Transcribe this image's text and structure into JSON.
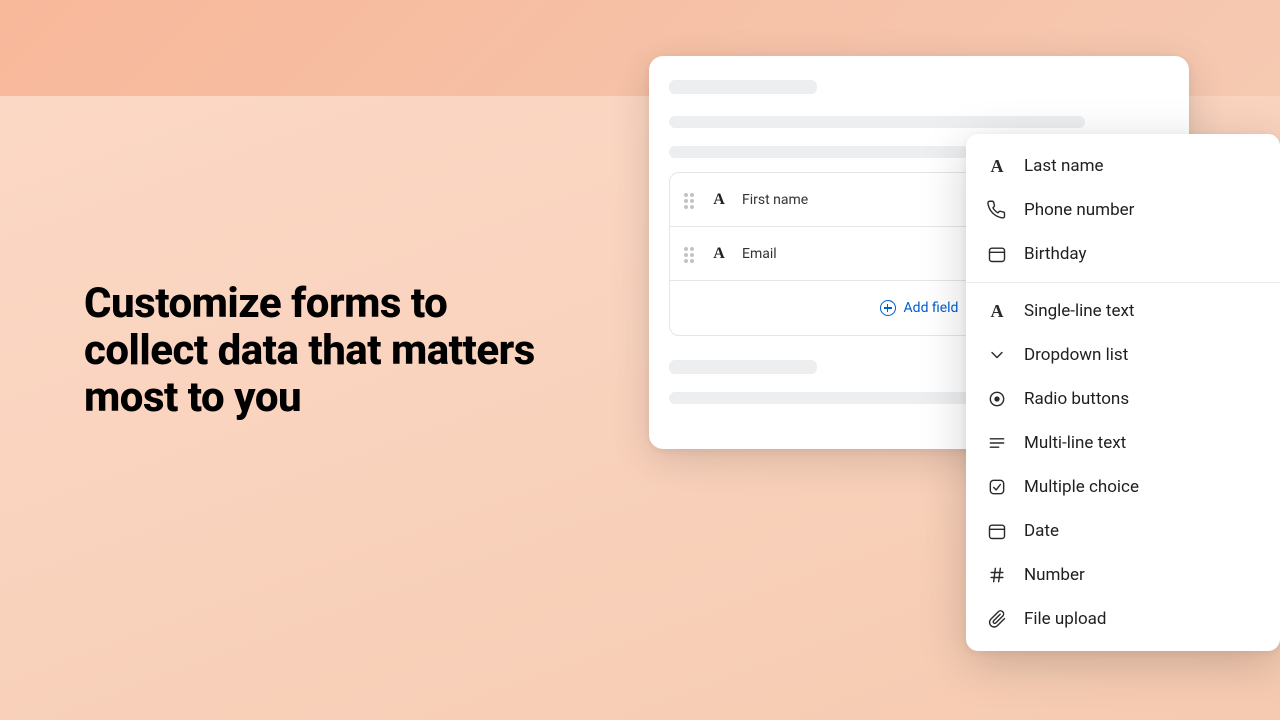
{
  "headline": "Customize forms to collect data that matters most to you",
  "form": {
    "fields": [
      {
        "label": "First name",
        "icon": "A"
      },
      {
        "label": "Email",
        "icon": "A"
      }
    ],
    "add_field_label": "Add field"
  },
  "menu": {
    "section1": [
      {
        "label": "Last name",
        "icon": "text"
      },
      {
        "label": "Phone number",
        "icon": "phone"
      },
      {
        "label": "Birthday",
        "icon": "calendar"
      }
    ],
    "section2": [
      {
        "label": "Single-line text",
        "icon": "text"
      },
      {
        "label": "Dropdown list",
        "icon": "chevron"
      },
      {
        "label": "Radio buttons",
        "icon": "radio"
      },
      {
        "label": "Multi-line text",
        "icon": "lines"
      },
      {
        "label": "Multiple choice",
        "icon": "checkbox"
      },
      {
        "label": "Date",
        "icon": "calendar"
      },
      {
        "label": "Number",
        "icon": "hash"
      },
      {
        "label": "File upload",
        "icon": "paperclip"
      }
    ]
  }
}
